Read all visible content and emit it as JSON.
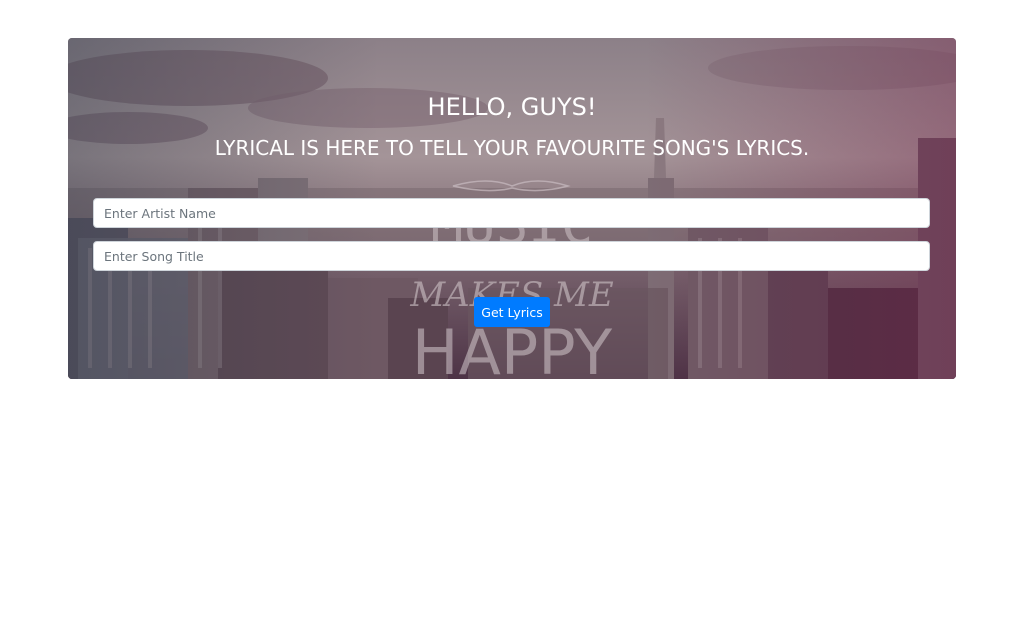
{
  "hero": {
    "greeting": "HELLO, GUYS!",
    "tagline": "LYRICAL IS HERE TO TELL YOUR FAVOURITE SONG'S LYRICS.",
    "background_image_text": [
      "MUSIC",
      "MAKES ME",
      "HAPPY"
    ]
  },
  "form": {
    "artist": {
      "placeholder": "Enter Artist Name",
      "value": ""
    },
    "song": {
      "placeholder": "Enter Song Title",
      "value": ""
    },
    "submit_label": "Get Lyrics"
  },
  "colors": {
    "button": "#007bff",
    "page_background": "#ffffff",
    "heading_text": "#ffffff"
  }
}
